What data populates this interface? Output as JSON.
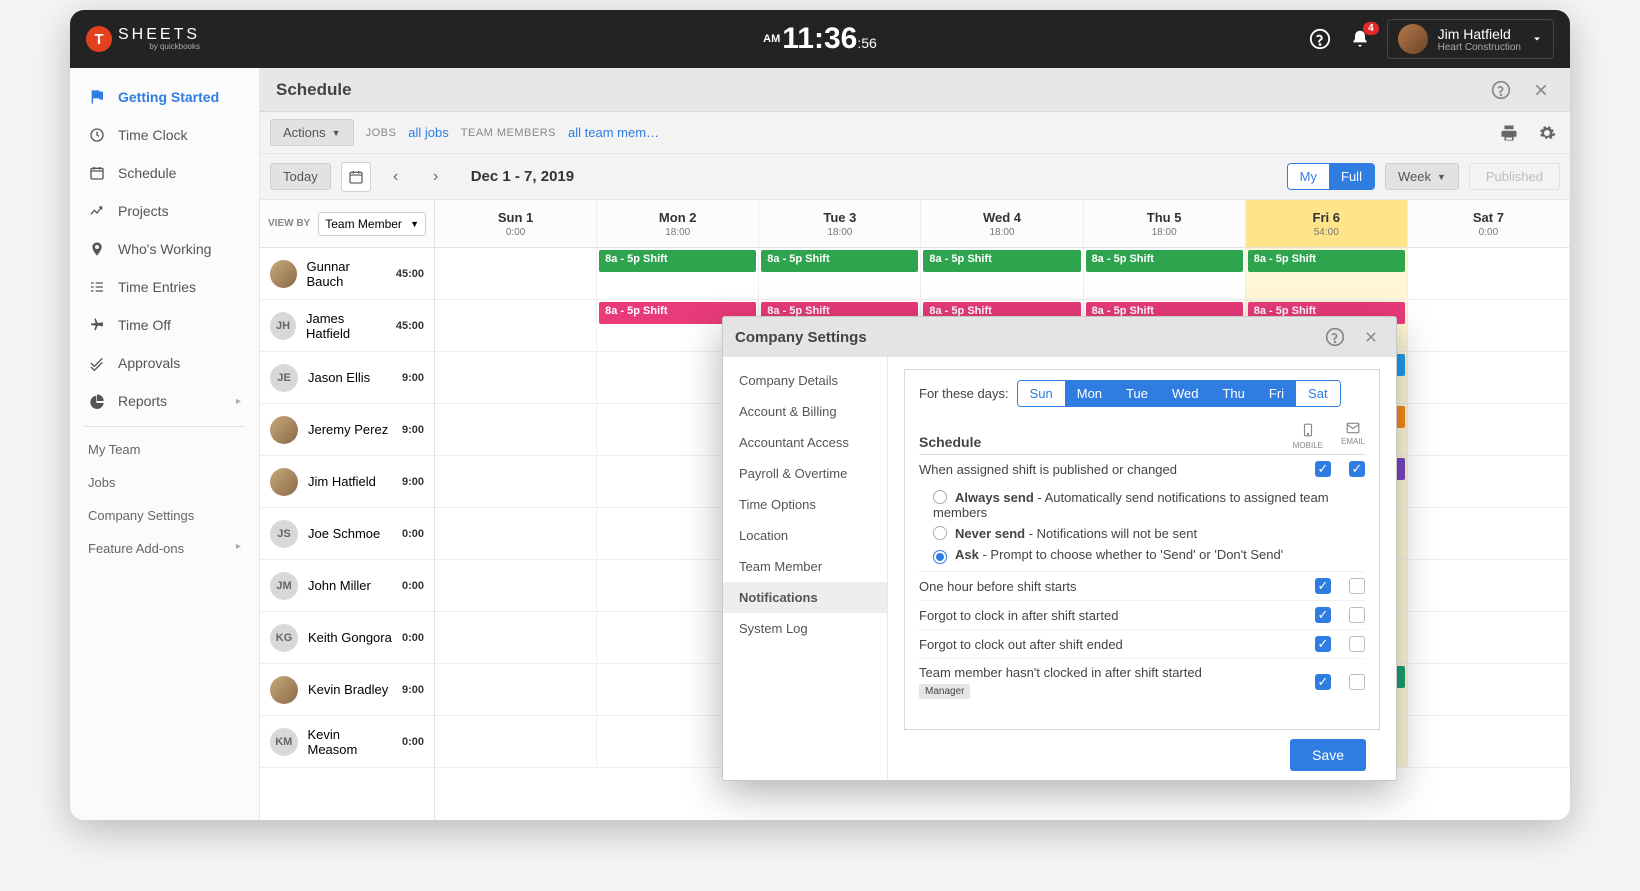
{
  "topbar": {
    "logo_letter": "T",
    "logo_text": "SHEETS",
    "logo_sub": "by quickbooks",
    "clock_ampm": "AM",
    "clock_hm": "11:36",
    "clock_sec": ":56",
    "notif_count": "4",
    "user_name": "Jim Hatfield",
    "user_company": "Heart Construction"
  },
  "sidebar": {
    "items": [
      {
        "label": "Getting Started",
        "icon": "flag",
        "active": true
      },
      {
        "label": "Time Clock",
        "icon": "clock"
      },
      {
        "label": "Schedule",
        "icon": "calendar"
      },
      {
        "label": "Projects",
        "icon": "trend"
      },
      {
        "label": "Who's Working",
        "icon": "pin"
      },
      {
        "label": "Time Entries",
        "icon": "list"
      },
      {
        "label": "Time Off",
        "icon": "plane"
      },
      {
        "label": "Approvals",
        "icon": "check"
      },
      {
        "label": "Reports",
        "icon": "pie",
        "chev": true
      }
    ],
    "sub": [
      "My Team",
      "Jobs",
      "Company Settings",
      "Feature Add-ons"
    ]
  },
  "page": {
    "title": "Schedule",
    "actions_btn": "Actions",
    "jobs_lbl": "JOBS",
    "jobs_val": "all jobs",
    "members_lbl": "TEAM MEMBERS",
    "members_val": "all team mem…",
    "today_btn": "Today",
    "date_range": "Dec 1 - 7, 2019",
    "my_lbl": "My",
    "full_lbl": "Full",
    "week_lbl": "Week",
    "published": "Published",
    "viewby_lbl": "VIEW BY",
    "viewby_val": "Team Member"
  },
  "days": [
    {
      "label": "Sun 1",
      "hours": "0:00"
    },
    {
      "label": "Mon 2",
      "hours": "18:00"
    },
    {
      "label": "Tue 3",
      "hours": "18:00"
    },
    {
      "label": "Wed 4",
      "hours": "18:00"
    },
    {
      "label": "Thu 5",
      "hours": "18:00"
    },
    {
      "label": "Fri 6",
      "hours": "54:00",
      "fri": true
    },
    {
      "label": "Sat 7",
      "hours": "0:00"
    }
  ],
  "members": [
    {
      "name": "Gunnar Bauch",
      "initials": "",
      "hours": "45:00",
      "shifts": [
        null,
        "green",
        "green",
        "green",
        "green",
        "green",
        null
      ]
    },
    {
      "name": "James Hatfield",
      "initials": "JH",
      "hours": "45:00",
      "shifts": [
        null,
        "pink",
        "pink",
        "pink",
        "pink",
        "pink",
        null
      ]
    },
    {
      "name": "Jason Ellis",
      "initials": "JE",
      "hours": "9:00",
      "shifts": [
        null,
        null,
        null,
        null,
        null,
        "blue",
        null
      ]
    },
    {
      "name": "Jeremy Perez",
      "initials": "",
      "hours": "9:00",
      "shifts": [
        null,
        null,
        null,
        null,
        null,
        "orange",
        null
      ]
    },
    {
      "name": "Jim Hatfield",
      "initials": "",
      "hours": "9:00",
      "shifts": [
        null,
        null,
        null,
        null,
        null,
        "purple",
        null
      ]
    },
    {
      "name": "Joe Schmoe",
      "initials": "JS",
      "hours": "0:00",
      "shifts": [
        null,
        null,
        null,
        null,
        null,
        null,
        null
      ]
    },
    {
      "name": "John Miller",
      "initials": "JM",
      "hours": "0:00",
      "shifts": [
        null,
        null,
        null,
        null,
        null,
        null,
        null
      ]
    },
    {
      "name": "Keith Gongora",
      "initials": "KG",
      "hours": "0:00",
      "shifts": [
        null,
        null,
        null,
        null,
        null,
        null,
        null
      ]
    },
    {
      "name": "Kevin Bradley",
      "initials": "",
      "hours": "9:00",
      "shifts": [
        null,
        null,
        null,
        null,
        null,
        "teal",
        null
      ]
    },
    {
      "name": "Kevin Measom",
      "initials": "KM",
      "hours": "0:00",
      "shifts": [
        null,
        null,
        null,
        null,
        null,
        null,
        null
      ]
    }
  ],
  "shift_label": "8a - 5p Shift",
  "modal": {
    "title": "Company Settings",
    "tabs": [
      "Company Details",
      "Account & Billing",
      "Accountant Access",
      "Payroll & Overtime",
      "Time Options",
      "Location",
      "Team Member",
      "Notifications",
      "System Log"
    ],
    "for_days_lbl": "For these days:",
    "day_btns": [
      "Sun",
      "Mon",
      "Tue",
      "Wed",
      "Thu",
      "Fri",
      "Sat"
    ],
    "section_title": "Schedule",
    "col_mobile": "MOBILE",
    "col_email": "EMAIL",
    "row1": "When assigned shift is published or changed",
    "opt_always_b": "Always send",
    "opt_always_t": " - Automatically send notifications to assigned team members",
    "opt_never_b": "Never send",
    "opt_never_t": " - Notifications will not be sent",
    "opt_ask_b": "Ask",
    "opt_ask_t": " - Prompt to choose whether to 'Send' or 'Don't Send'",
    "row2": "One hour before shift starts",
    "row3": "Forgot to clock in after shift started",
    "row4": "Forgot to clock out after shift ended",
    "row5": "Team member hasn't clocked in after shift started",
    "manager_tag": "Manager",
    "save": "Save"
  }
}
